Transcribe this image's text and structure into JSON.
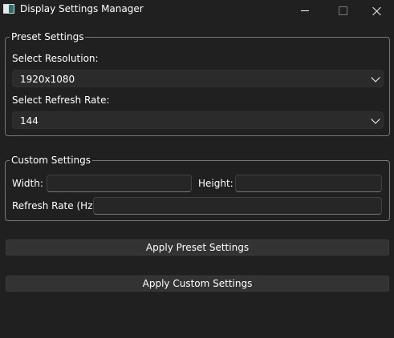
{
  "window": {
    "title": "Display Settings Manager",
    "icon": "app-icon",
    "controls": {
      "minimize": "minimize-icon",
      "maximize": "maximize-icon",
      "close": "close-icon"
    }
  },
  "preset": {
    "group_title": "Preset Settings",
    "resolution_label": "Select Resolution:",
    "resolution_value": "1920x1080",
    "refresh_label": "Select Refresh Rate:",
    "refresh_value": "144"
  },
  "custom": {
    "group_title": "Custom Settings",
    "width_label": "Width:",
    "width_value": "",
    "height_label": "Height:",
    "height_value": "",
    "refresh_label": "Refresh Rate (Hz):",
    "refresh_value": ""
  },
  "buttons": {
    "apply_preset": "Apply Preset Settings",
    "apply_custom": "Apply Custom Settings"
  }
}
